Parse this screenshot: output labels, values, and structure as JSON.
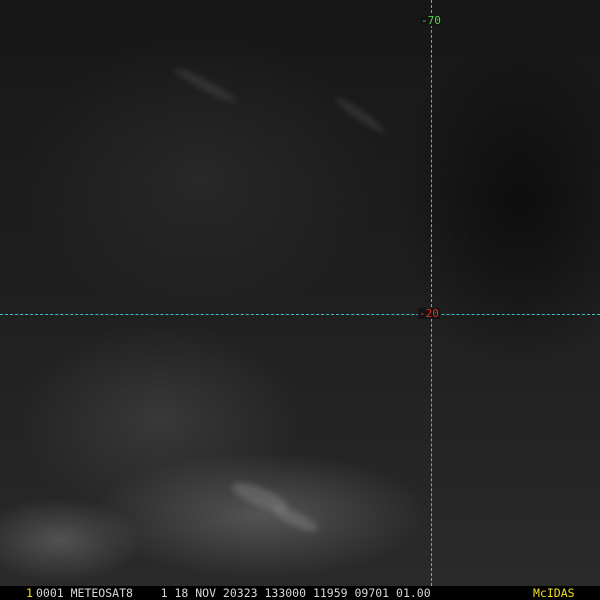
{
  "image": {
    "grid": {
      "longitude_label": "-70",
      "latitude_label": "-20",
      "line_color": "#35c2c8",
      "longitude_label_color": "#56d24a",
      "latitude_label_color": "#e0302a"
    }
  },
  "info_bar": {
    "frame_number": "1",
    "text": "0001 METEOSAT8    1 18 NOV 20323 133000 11959 09701 01.00",
    "brand": "McIDAS",
    "text_color": "#d8d8d8",
    "accent_color": "#f0e020"
  }
}
